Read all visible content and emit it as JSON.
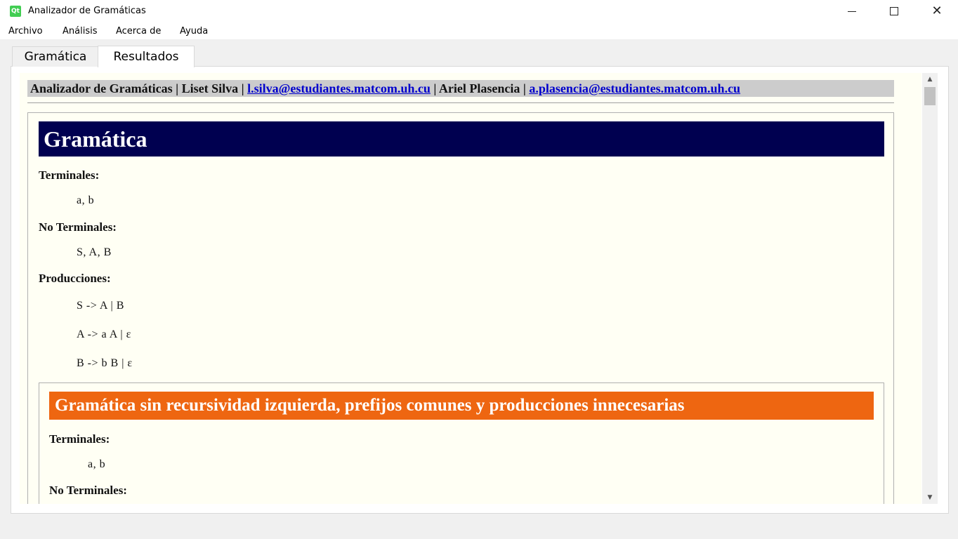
{
  "window": {
    "title": "Analizador de Gramáticas",
    "icon_name": "qt-app-icon",
    "icon_text": "Qt"
  },
  "menu": [
    "Archivo",
    "Análisis",
    "Acerca de",
    "Ayuda"
  ],
  "tabs": [
    "Gramática",
    "Resultados"
  ],
  "active_tab": "Resultados",
  "header": {
    "app": "Analizador de Gramáticas",
    "sep": "|",
    "author1": "Liset Silva",
    "email1": "l.silva@estudiantes.matcom.uh.cu",
    "author2": "Ariel Plasencia",
    "email2": "a.plasencia@estudiantes.matcom.uh.cu"
  },
  "grammar": {
    "title": "Gramática",
    "terminales_label": "Terminales:",
    "terminales": "a, b",
    "no_terminales_label": "No Terminales:",
    "no_terminales": "S, A, B",
    "producciones_label": "Producciones:",
    "producciones": [
      "S -> A | B",
      "A -> a A | ε",
      "B -> b B | ε"
    ]
  },
  "clean_grammar": {
    "title": "Gramática sin recursividad izquierda, prefijos comunes y producciones innecesarias",
    "terminales_label": "Terminales:",
    "terminales": "a, b",
    "no_terminales_label": "No Terminales:"
  },
  "colors": {
    "grammar_title_bg": "#000050",
    "sub_title_bg": "#ee6611",
    "page_bg": "#fffff4",
    "link": "#0000cc"
  }
}
